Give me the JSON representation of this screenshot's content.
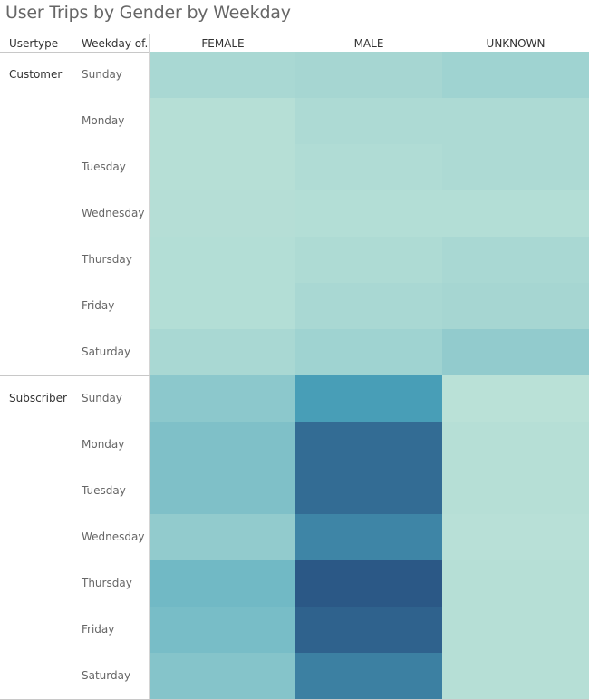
{
  "title": "User Trips by Gender by Weekday",
  "headers": {
    "usertype": "Usertype",
    "weekday": "Weekday of..",
    "genders": [
      "FEMALE",
      "MALE",
      "UNKNOWN"
    ]
  },
  "groups": [
    {
      "name": "Customer",
      "weekdays": [
        "Sunday",
        "Monday",
        "Tuesday",
        "Wednesday",
        "Thursday",
        "Friday",
        "Saturday"
      ]
    },
    {
      "name": "Subscriber",
      "weekdays": [
        "Sunday",
        "Monday",
        "Tuesday",
        "Wednesday",
        "Thursday",
        "Friday",
        "Saturday"
      ]
    }
  ],
  "colors": {
    "low": "#bde3d8",
    "high": "#2b5886",
    "mid": "#4aa3bb"
  },
  "chart_data": {
    "type": "heatmap",
    "title": "User Trips by Gender by Weekday",
    "x_categories": [
      "FEMALE",
      "MALE",
      "UNKNOWN"
    ],
    "row_groups": [
      "Customer",
      "Subscriber"
    ],
    "y_categories": [
      "Sunday",
      "Monday",
      "Tuesday",
      "Wednesday",
      "Thursday",
      "Friday",
      "Saturday"
    ],
    "scale": "relative intensity 0-100 (no legend shown)",
    "values": {
      "Customer": [
        [
          12,
          14,
          18
        ],
        [
          4,
          10,
          10
        ],
        [
          4,
          8,
          10
        ],
        [
          5,
          6,
          6
        ],
        [
          6,
          9,
          12
        ],
        [
          6,
          12,
          14
        ],
        [
          12,
          18,
          26
        ]
      ],
      "Subscriber": [
        [
          30,
          72,
          2
        ],
        [
          38,
          92,
          4
        ],
        [
          38,
          92,
          4
        ],
        [
          26,
          82,
          3
        ],
        [
          46,
          100,
          4
        ],
        [
          42,
          96,
          4
        ],
        [
          34,
          84,
          4
        ]
      ]
    }
  }
}
